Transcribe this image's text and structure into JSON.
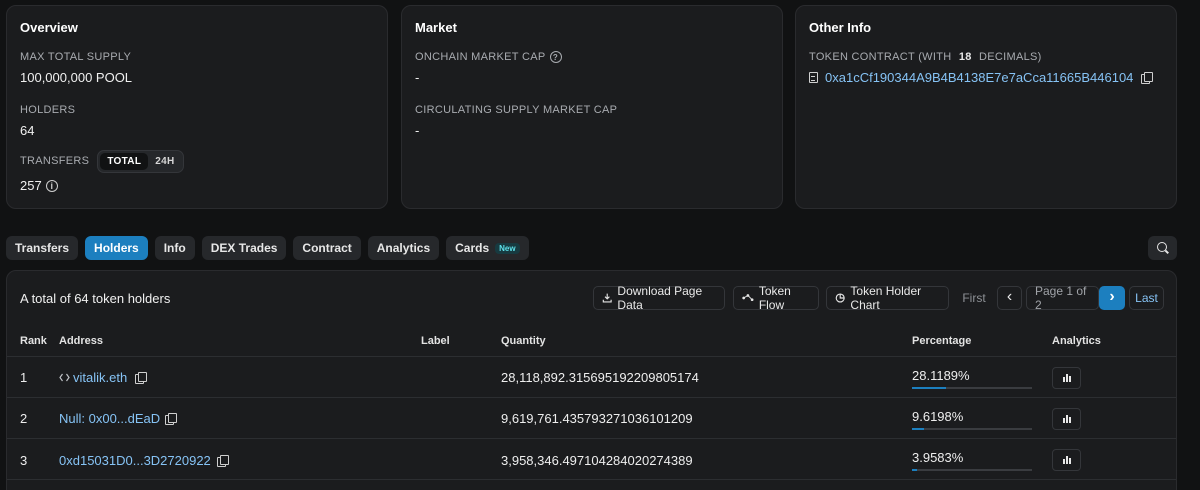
{
  "overview": {
    "title": "Overview",
    "max_supply_label": "MAX TOTAL SUPPLY",
    "max_supply_value": "100,000,000 POOL",
    "holders_label": "HOLDERS",
    "holders_value": "64",
    "transfers_label": "TRANSFERS",
    "transfers_toggle": [
      "TOTAL",
      "24H"
    ],
    "transfers_value": "257",
    "info_glyph": "i"
  },
  "market": {
    "title": "Market",
    "onchain_label": "ONCHAIN MARKET CAP",
    "onchain_value": "-",
    "help_glyph": "?",
    "circ_label": "CIRCULATING SUPPLY MARKET CAP",
    "circ_value": "-"
  },
  "other": {
    "title": "Other Info",
    "contract_label_pre": "TOKEN CONTRACT (WITH ",
    "contract_decimals": "18",
    "contract_label_post": " DECIMALS)",
    "contract_address": "0xa1cCf190344A9B4B4138E7e7aCca11665B446104"
  },
  "tabs": [
    {
      "label": "Transfers"
    },
    {
      "label": "Holders"
    },
    {
      "label": "Info"
    },
    {
      "label": "DEX Trades"
    },
    {
      "label": "Contract"
    },
    {
      "label": "Analytics"
    },
    {
      "label": "Cards",
      "badge": "New"
    }
  ],
  "active_tab": "Holders",
  "holders": {
    "total_text": "A total of 64 token holders",
    "download_label": "Download Page Data",
    "token_flow_label": "Token Flow",
    "holder_chart_label": "Token Holder Chart",
    "pagination": {
      "first": "First",
      "prev": "‹",
      "page": "Page 1 of 2",
      "next": "›",
      "last": "Last"
    },
    "columns": {
      "rank": "Rank",
      "address": "Address",
      "label": "Label",
      "quantity": "Quantity",
      "percentage": "Percentage",
      "analytics": "Analytics"
    },
    "rows": [
      {
        "rank": "1",
        "address": "vitalik.eth",
        "label": "",
        "quantity": "28,118,892.315695192209805174",
        "percentage": "28.1189%",
        "pct": 0.281189
      },
      {
        "rank": "2",
        "address": "Null: 0x00...dEaD",
        "label": "",
        "quantity": "9,619,761.435793271036101209",
        "percentage": "9.6198%",
        "pct": 0.096198
      },
      {
        "rank": "3",
        "address": "0xd15031D0...3D2720922",
        "label": "",
        "quantity": "3,958,346.497104284020274389",
        "percentage": "3.9583%",
        "pct": 0.039583
      }
    ]
  },
  "colors": {
    "accent": "#1c7fbf",
    "link": "#86c3f5",
    "background": "#111213",
    "card": "#1b1c1e"
  }
}
